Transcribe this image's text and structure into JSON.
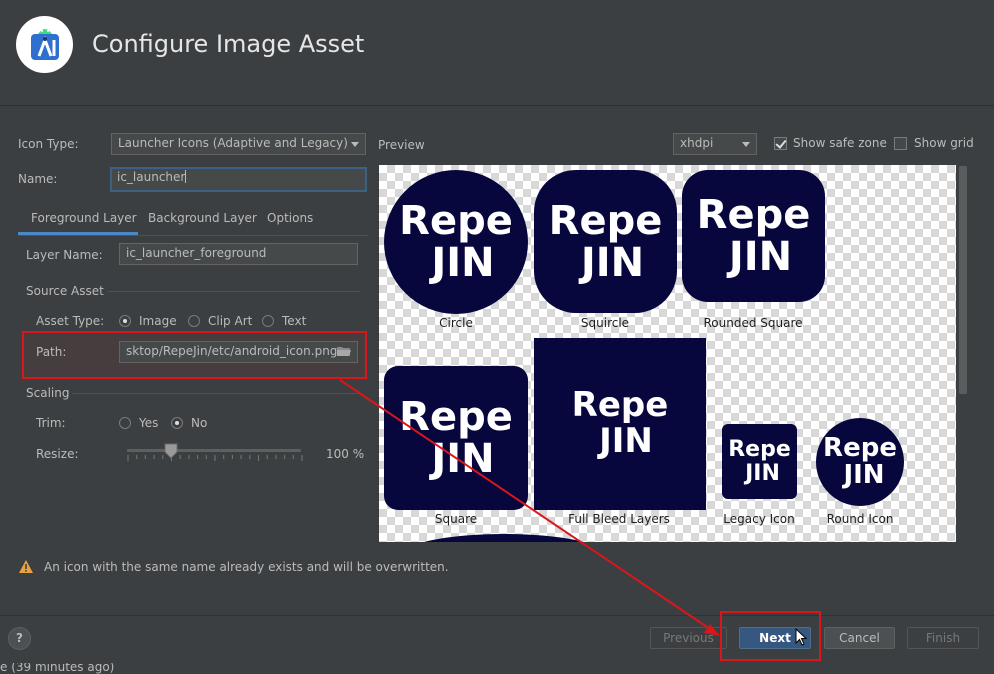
{
  "window": {
    "title": "Configure Image Asset"
  },
  "form": {
    "icon_type_label": "Icon Type:",
    "icon_type_value": "Launcher Icons (Adaptive and Legacy)",
    "name_label": "Name:",
    "name_value": "ic_launcher"
  },
  "tabs": [
    {
      "label": "Foreground Layer",
      "selected": true
    },
    {
      "label": "Background Layer",
      "selected": false
    },
    {
      "label": "Options",
      "selected": false
    }
  ],
  "layer": {
    "layer_name_label": "Layer Name:",
    "layer_name_value": "ic_launcher_foreground",
    "source_asset_heading": "Source Asset",
    "asset_type_label": "Asset Type:",
    "asset_type_options": [
      "Image",
      "Clip Art",
      "Text"
    ],
    "asset_type_selected": "Image",
    "path_label": "Path:",
    "path_value": "sktop/RepeJin/etc/android_icon.png",
    "scaling_heading": "Scaling",
    "trim_label": "Trim:",
    "trim_options": [
      "Yes",
      "No"
    ],
    "trim_selected": "No",
    "resize_label": "Resize:",
    "resize_value": "100 %",
    "resize_percent": 100
  },
  "preview": {
    "label": "Preview",
    "density": "xhdpi",
    "show_safe_zone_label": "Show safe zone",
    "show_safe_zone": true,
    "show_grid_label": "Show grid",
    "show_grid": false,
    "icon_text_line1": "Repe",
    "icon_text_line2": "JIN",
    "captions": [
      "Circle",
      "Squircle",
      "Rounded Square",
      "Square",
      "Full Bleed Layers",
      "Legacy Icon",
      "Round Icon"
    ]
  },
  "warning": {
    "text": "An icon with the same name already exists and will be overwritten."
  },
  "buttons": {
    "help": "?",
    "previous": "Previous",
    "next": "Next",
    "cancel": "Cancel",
    "finish": "Finish"
  },
  "status_bar": {
    "text": "e   (39 minutes ago)"
  },
  "colors": {
    "icon_background": "#07073d",
    "annotation_red": "#d9161b",
    "accent_blue": "#4a88c7"
  }
}
